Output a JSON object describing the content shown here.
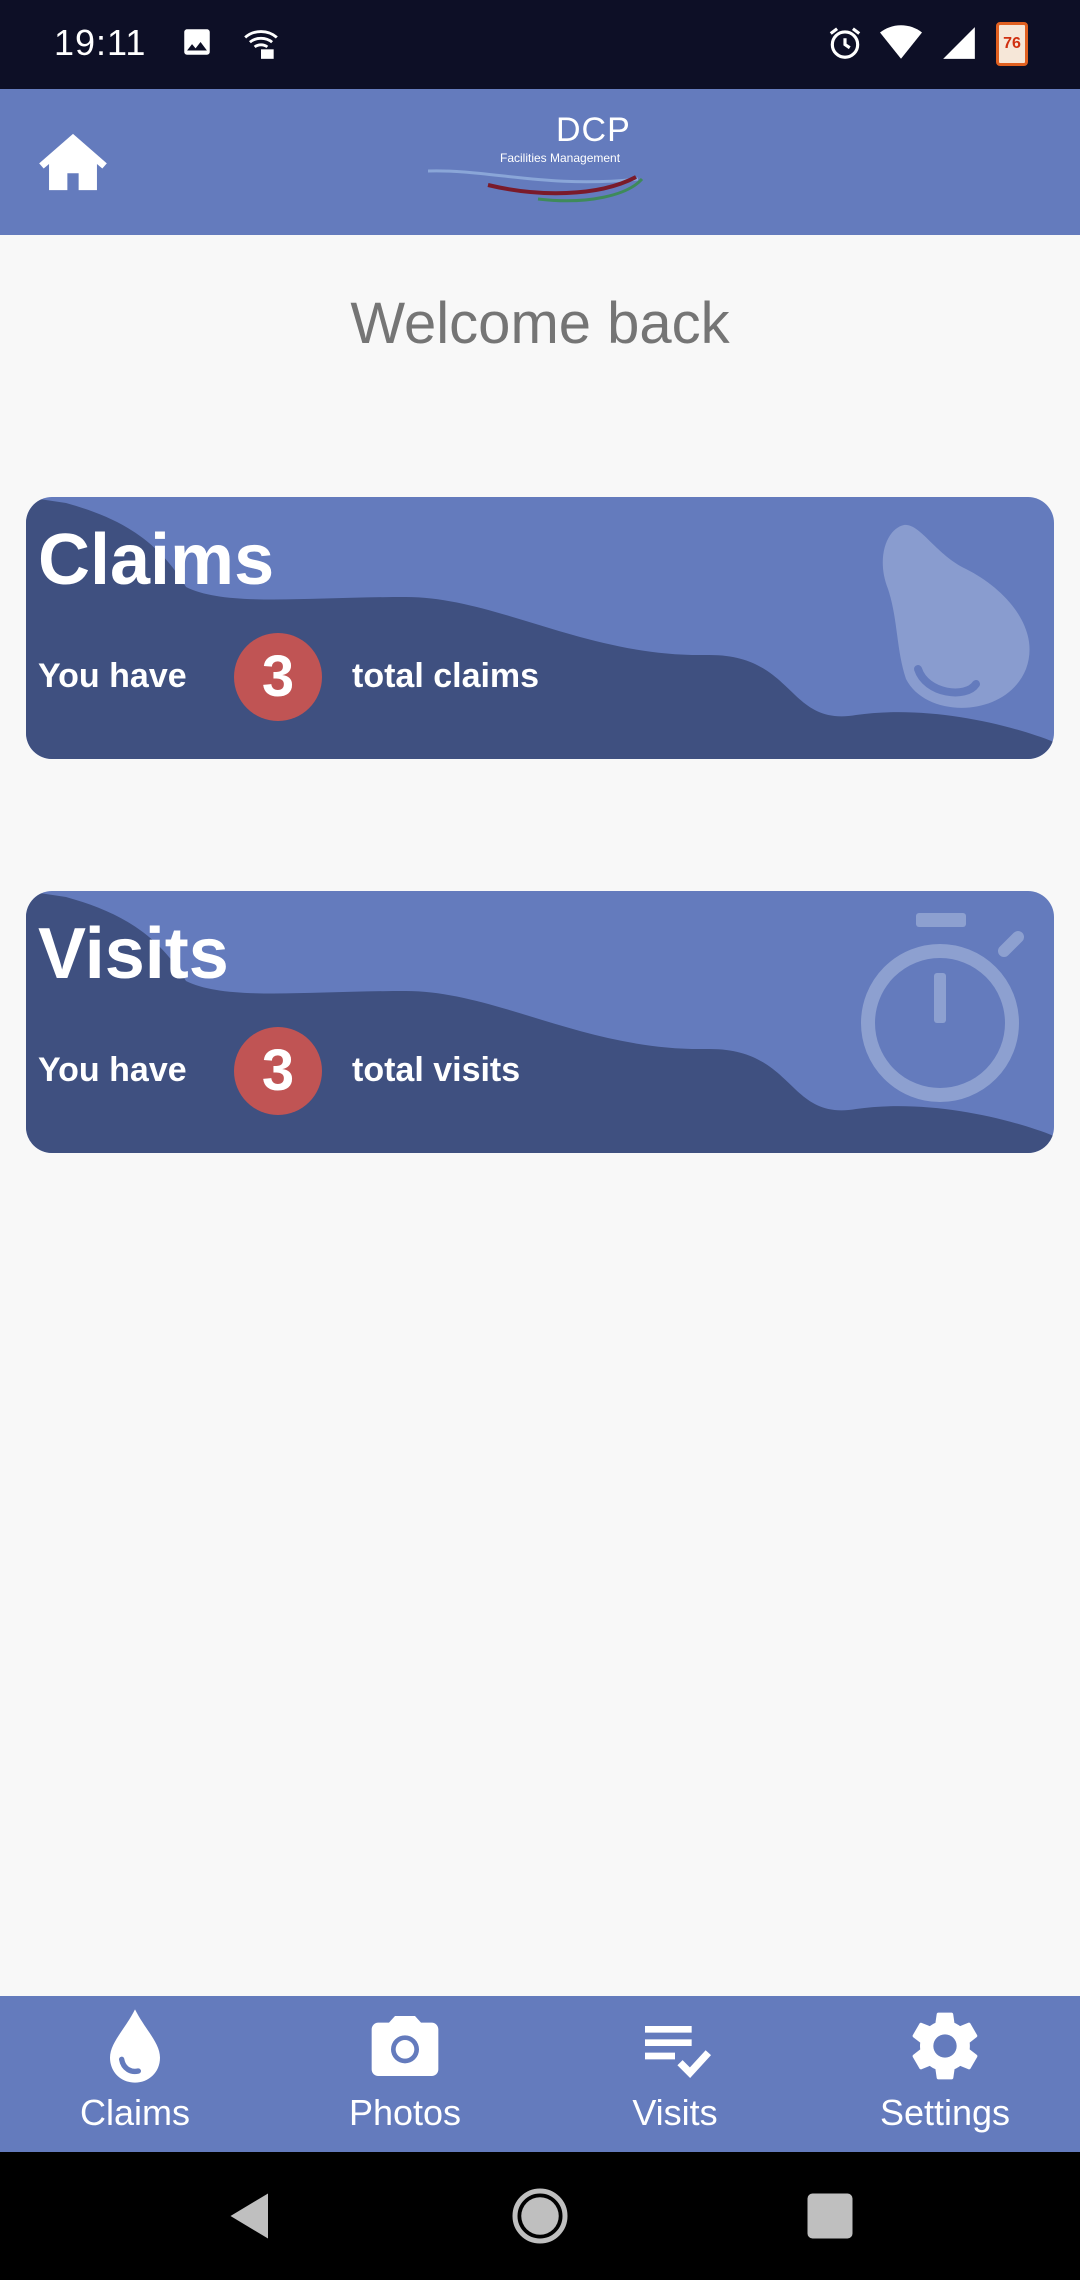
{
  "status_bar": {
    "time": "19:11",
    "battery_level": "76",
    "icons": [
      "image-icon",
      "wifi-lock-icon",
      "alarm-icon",
      "wifi-icon",
      "signal-icon",
      "battery-icon"
    ]
  },
  "app_bar": {
    "home_icon": "home-icon",
    "logo_title": "DCP",
    "logo_subtitle": "Facilities Management"
  },
  "welcome": "Welcome back",
  "cards": {
    "claims": {
      "title": "Claims",
      "prefix": "You have",
      "count": "3",
      "suffix": "total claims",
      "icon": "water-drop-icon"
    },
    "visits": {
      "title": "Visits",
      "prefix": "You have",
      "count": "3",
      "suffix": "total visits",
      "icon": "stopwatch-icon"
    }
  },
  "bottom_nav": [
    {
      "label": "Claims",
      "icon": "water-drop-icon"
    },
    {
      "label": "Photos",
      "icon": "camera-icon"
    },
    {
      "label": "Visits",
      "icon": "checklist-icon"
    },
    {
      "label": "Settings",
      "icon": "gear-icon"
    }
  ],
  "colors": {
    "primary": "#647bbd",
    "wave_dark": "#3f5080",
    "badge": "#c05454",
    "status_bar": "#0d0f26",
    "welcome_text": "#757575"
  }
}
